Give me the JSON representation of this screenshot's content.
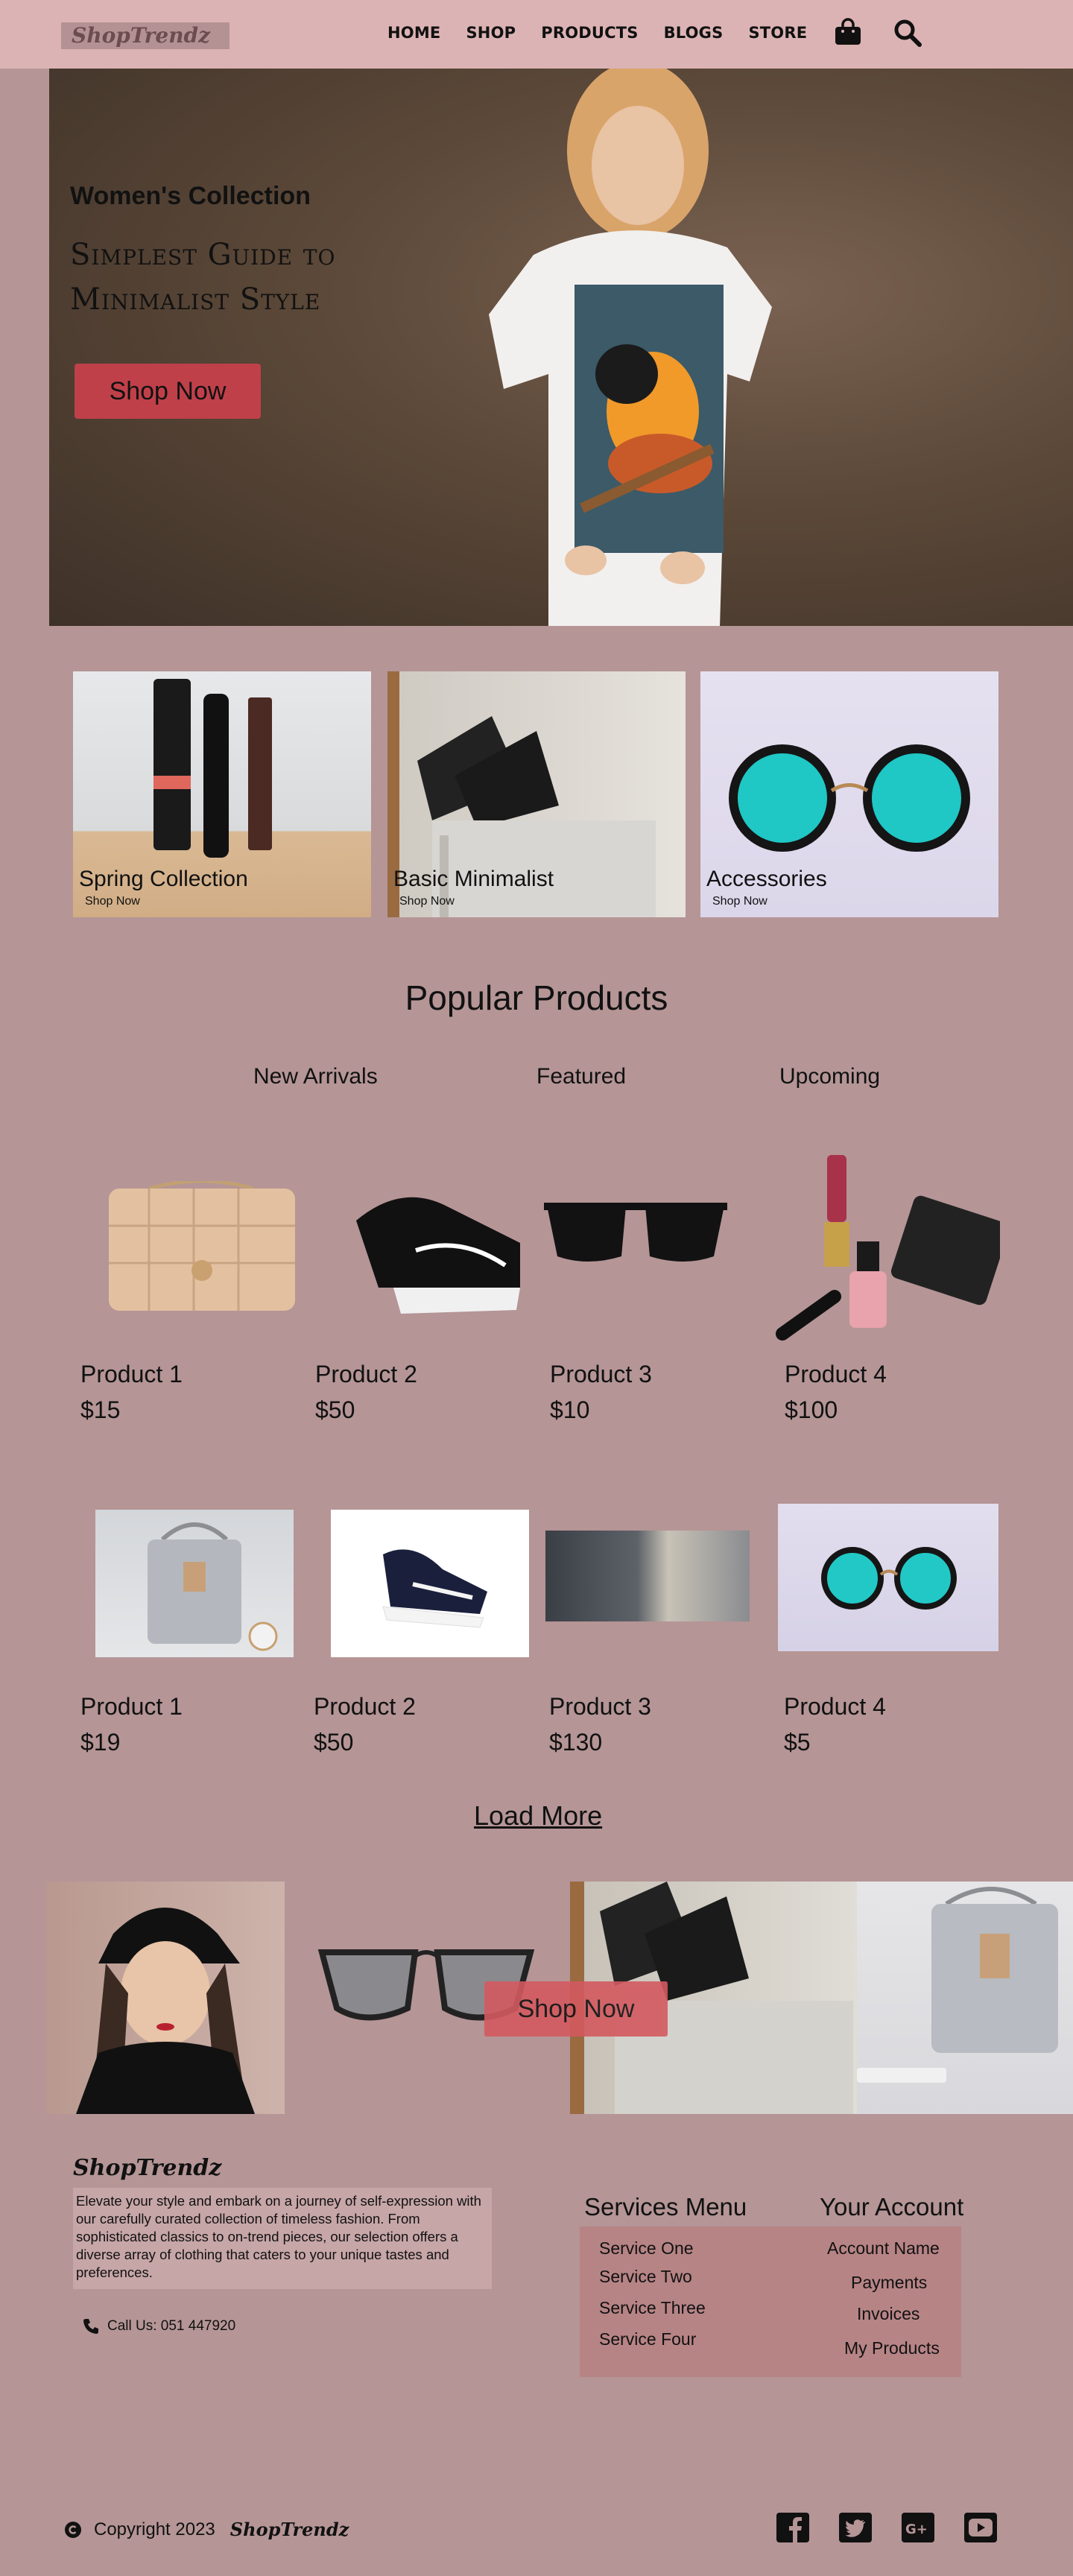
{
  "header": {
    "logo": "ShopTrendz",
    "nav": [
      "HOME",
      "SHOP",
      "PRODUCTS",
      "BLOGS",
      "STORE"
    ],
    "icons": [
      "shopping-bag-icon",
      "search-icon"
    ]
  },
  "hero": {
    "subtitle": "Women's Collection",
    "title_line1": "Simplest Guide to",
    "title_line2": "Minimalist Style",
    "button": "Shop Now"
  },
  "categories": [
    {
      "title": "Spring Collection",
      "link": "Shop Now"
    },
    {
      "title": "Basic Minimalist",
      "link": "Shop Now"
    },
    {
      "title": "Accessories",
      "link": "Shop Now"
    }
  ],
  "popular": {
    "title": "Popular Products",
    "tabs": [
      "New Arrivals",
      "Featured",
      "Upcoming"
    ],
    "row1": [
      {
        "name": "Product 1",
        "price": "$15"
      },
      {
        "name": "Product 2",
        "price": "$50"
      },
      {
        "name": "Product 3",
        "price": "$10"
      },
      {
        "name": "Product 4",
        "price": "$100"
      }
    ],
    "row2": [
      {
        "name": "Product 1",
        "price": "$19"
      },
      {
        "name": "Product 2",
        "price": "$50"
      },
      {
        "name": "Product 3",
        "price": "$130"
      },
      {
        "name": "Product 4",
        "price": "$5"
      }
    ],
    "load_more": "Load More"
  },
  "banner": {
    "button": "Shop Now"
  },
  "footer": {
    "logo": "ShopTrendz",
    "description": "Elevate your style and embark on a journey of self-expression with our carefully curated collection of timeless fashion. From sophisticated classics to on-trend pieces, our selection offers a diverse array of clothing that caters to your unique tastes and preferences.",
    "call": "Call Us: 051 447920",
    "services_title": "Services Menu",
    "services": [
      "Service One",
      "Service Two",
      "Service Three",
      "Service Four"
    ],
    "account_title": "Your Account",
    "account": [
      "Account Name",
      "Payments",
      "Invoices",
      "My Products"
    ],
    "copyright": "Copyright 2023",
    "brand": "ShopTrendz",
    "social": [
      "facebook-icon",
      "twitter-icon",
      "google-plus-icon",
      "youtube-icon"
    ]
  },
  "colors": {
    "page_bg": "#b59596",
    "header_bg": "#dcb3b4",
    "accent_button": "#c0404a",
    "footer_box": "#b78486"
  }
}
